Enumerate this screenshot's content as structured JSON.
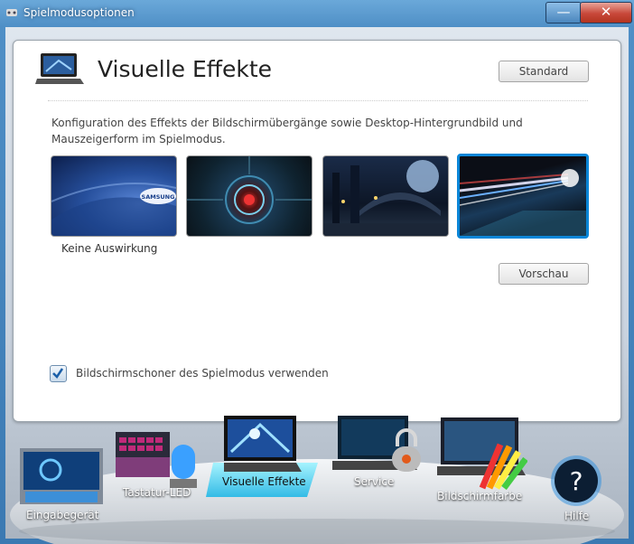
{
  "window": {
    "title": "Spielmodusoptionen",
    "minimize_label": "—",
    "close_label": "✕"
  },
  "panel": {
    "heading": "Visuelle Effekte",
    "standard_label": "Standard",
    "description": "Konfiguration des Effekts der Bildschirmübergänge sowie Desktop-Hintergrundbild und Mauszeigerform im Spielmodus.",
    "thumbnails": [
      {
        "name": "samsung-wallpaper",
        "label": "Keine Auswirkung",
        "logo_text": "SAMSUNG",
        "selected": false
      },
      {
        "name": "tech-circle-wallpaper",
        "label": "",
        "selected": false
      },
      {
        "name": "fantasy-city-wallpaper",
        "label": "",
        "selected": false
      },
      {
        "name": "light-streak-wallpaper",
        "label": "",
        "selected": true
      }
    ],
    "preview_label": "Vorschau",
    "checkbox": {
      "label": "Bildschirmschoner des Spielmodus verwenden",
      "checked": true
    }
  },
  "dock": {
    "items": [
      {
        "label": "Eingabegerät",
        "icon": "input-device-icon"
      },
      {
        "label": "Tastatur-LED",
        "icon": "keyboard-led-icon"
      },
      {
        "label": "Visuelle Effekte",
        "icon": "visual-effects-icon",
        "active": true
      },
      {
        "label": "Service",
        "icon": "service-lock-icon"
      },
      {
        "label": "Bildschirmfarbe",
        "icon": "screen-color-icon"
      },
      {
        "label": "Hilfe",
        "icon": "help-icon"
      }
    ]
  },
  "colors": {
    "accent": "#0a86d8",
    "titlebar": "#4f8fc6",
    "close": "#c8483a"
  }
}
